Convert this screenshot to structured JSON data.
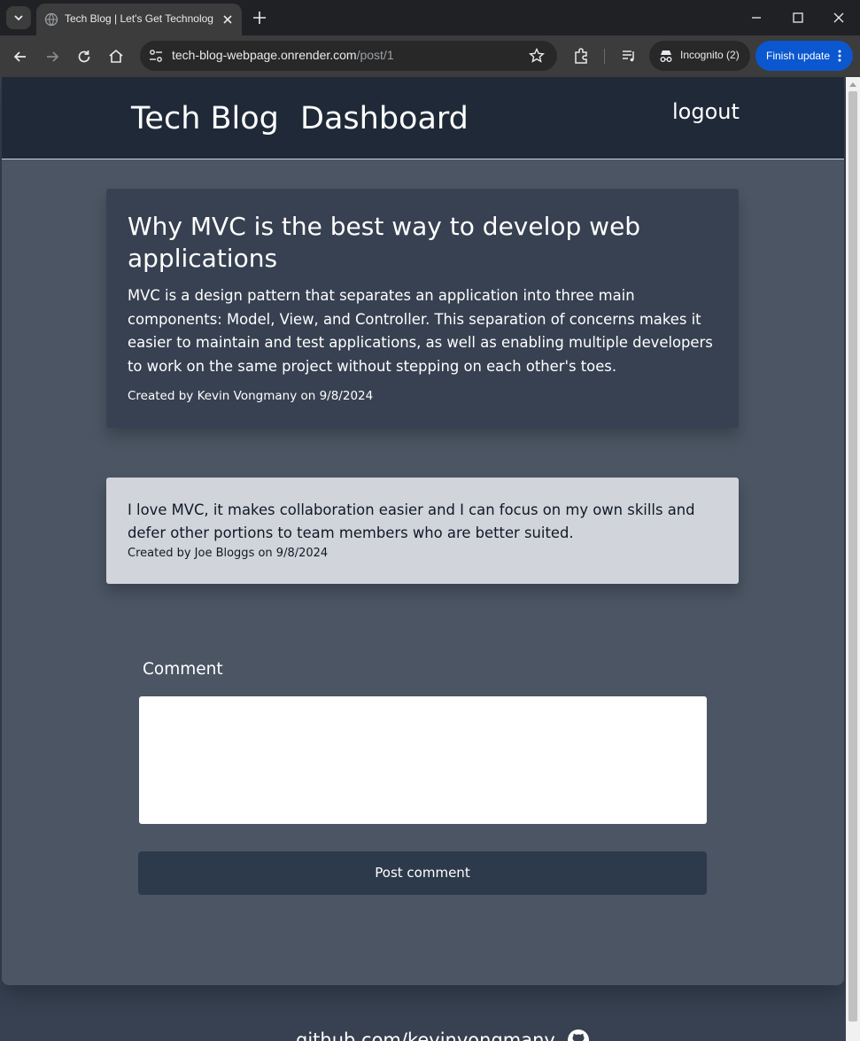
{
  "browser": {
    "tab_title": "Tech Blog | Let's Get Technological",
    "url_host": "tech-blog-webpage.onrender.com",
    "url_path": "/post/1",
    "profile_label": "Incognito (2)",
    "update_label": "Finish update"
  },
  "header": {
    "brand": "Tech Blog",
    "dashboard_link": "Dashboard",
    "logout_link": "logout"
  },
  "post": {
    "title": "Why MVC is the best way to develop web applications",
    "body": "MVC is a design pattern that separates an application into three main components: Model, View, and Controller. This separation of concerns makes it easier to maintain and test applications, as well as enabling multiple developers to work on the same project without stepping on each other's toes.",
    "meta": "Created by Kevin Vongmany on 9/8/2024"
  },
  "comments": [
    {
      "body": "I love MVC, it makes collaboration easier and I can focus on my own skills and defer other portions to team members who are better suited.",
      "meta": "Created by Joe Bloggs on 9/8/2024"
    }
  ],
  "comment_form": {
    "label": "Comment",
    "value": "",
    "submit_label": "Post comment"
  },
  "footer": {
    "link": "github.com/kevinvongmany"
  },
  "colors": {
    "header_bg": "#1f2937",
    "page_bg": "#4b5563",
    "card_bg": "#374151",
    "comment_bg": "#d1d5db",
    "button_bg": "#2d3a4b",
    "chrome_accent": "#0b57d0"
  }
}
